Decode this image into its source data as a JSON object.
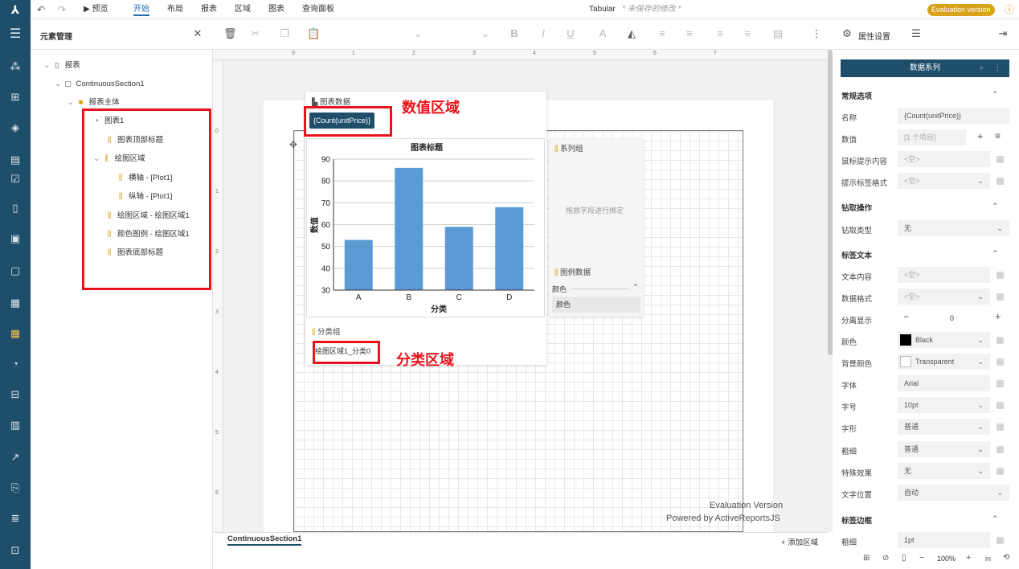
{
  "topbar": {
    "logo": "⅄",
    "undo": "↶",
    "redo": "↷",
    "preview": "▶ 预览",
    "tabs": [
      "开始",
      "布局",
      "报表",
      "区域",
      "图表",
      "查询面板"
    ],
    "doc_type": "Tabular",
    "unsaved": "* 未保存的修改 *",
    "eval_badge": "Evaluation version",
    "eval_color": "#d9a21b",
    "info_icon": "ⓘ"
  },
  "toolbar": {
    "element_manager": "元素管理"
  },
  "tree": {
    "report": "报表",
    "section": "ContinuousSection1",
    "body": "报表主体",
    "chart": "图表1",
    "chart_top_title": "图表顶部标题",
    "plot_area": "绘图区域",
    "x_axis": "横轴 - [Plot1]",
    "y_axis": "纵轴 - [Plot1]",
    "plot_area_1": "绘图区域 - 绘图区域1",
    "color_legend": "颜色图例 - 绘图区域1",
    "chart_bottom_title": "图表底部标题"
  },
  "chart_panel": {
    "data_header": "图表数据",
    "data_value": "{Count(unitPrice)}",
    "value_label_red": "数值区域",
    "series_header": "系列组",
    "drop_hint": "拖放字段进行绑定",
    "legend_header": "图例数据",
    "legend_color_label": "颜色",
    "legend_color_value": "颜色",
    "category_header": "分类组",
    "category_value": "绘图区域1_分类0",
    "category_label_red": "分类区域"
  },
  "chart_data": {
    "type": "bar",
    "title": "图表标题",
    "xlabel": "分类",
    "ylabel": "数值",
    "categories": [
      "A",
      "B",
      "C",
      "D"
    ],
    "values": [
      53,
      86,
      59,
      68
    ],
    "ylim": [
      30,
      90
    ],
    "yticks": [
      "30",
      "40",
      "50",
      "60",
      "70",
      "80",
      "90"
    ],
    "bar_color": "#5b9bd5"
  },
  "canvas": {
    "eval_line1": "Evaluation Version",
    "eval_line2": "Powered by ActiveReportsJS",
    "section_tab": "ContinuousSection1",
    "add_region": "+ 添加区域",
    "zoom": "100%",
    "ruler_numbers": [
      "0",
      "1",
      "2",
      "3",
      "4",
      "5",
      "6",
      "7"
    ],
    "ruler_left_numbers": [
      "0",
      "1",
      "2",
      "3",
      "4",
      "5",
      "6"
    ]
  },
  "props": {
    "tab_props": "属性设置",
    "header_button": "数据系列",
    "sec_general": "常规选项",
    "name_label": "名称",
    "name_value": "{Count(unitPrice)}",
    "value_label": "数值",
    "value_value": "[1 个项目]",
    "tooltip_label": "鼠标提示内容",
    "tooltip_value": "<空>",
    "tooltip_fmt_label": "提示标签格式",
    "tooltip_fmt_value": "<空>",
    "sec_drill": "钻取操作",
    "drill_type_label": "钻取类型",
    "drill_type_value": "无",
    "sec_label_text": "标签文本",
    "text_content_label": "文本内容",
    "text_content_value": "<空>",
    "data_fmt_label": "数据格式",
    "data_fmt_value": "<空>",
    "separate_label": "分离显示",
    "separate_value": "0",
    "color_label": "颜色",
    "color_value": "Black",
    "bg_color_label": "背景颜色",
    "bg_color_value": "Transparent",
    "font_label": "字体",
    "font_value": "Arial",
    "font_size_label": "字号",
    "font_size_value": "10pt",
    "font_style_label": "字形",
    "font_style_value": "普通",
    "font_weight_label": "粗细",
    "font_weight_value": "普通",
    "effect_label": "特殊效果",
    "effect_value": "无",
    "text_pos_label": "文字位置",
    "text_pos_value": "自动",
    "sec_label_border": "标签边框",
    "border_width_label": "粗细",
    "border_width_value": "1pt"
  }
}
